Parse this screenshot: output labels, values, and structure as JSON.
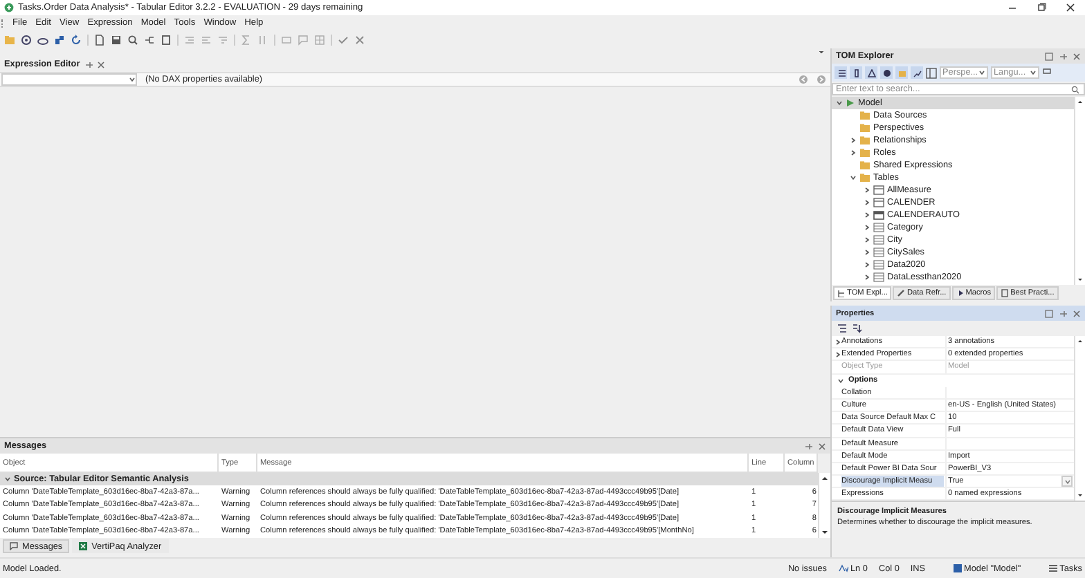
{
  "window": {
    "title": "Tasks.Order Data Analysis* - Tabular Editor 3.2.2 - EVALUATION - 29 days remaining"
  },
  "menu": [
    "File",
    "Edit",
    "View",
    "Expression",
    "Model",
    "Tools",
    "Window",
    "Help"
  ],
  "expression_editor": {
    "title": "Expression Editor",
    "message": "(No DAX properties available)"
  },
  "messages": {
    "title": "Messages",
    "columns": [
      "Object",
      "Type",
      "Message",
      "Line",
      "Column"
    ],
    "group": {
      "label": "Source: Tabular Editor Semantic Analysis",
      "expanded": true
    },
    "rows": [
      {
        "object": "Column 'DateTableTemplate_603d16ec-8ba7-42a3-87a...",
        "type": "Warning",
        "message": "Column references should always be fully qualified: 'DateTableTemplate_603d16ec-8ba7-42a3-87ad-4493ccc49b95'[Date]",
        "line": "1",
        "column": "6"
      },
      {
        "object": "Column 'DateTableTemplate_603d16ec-8ba7-42a3-87a...",
        "type": "Warning",
        "message": "Column references should always be fully qualified: 'DateTableTemplate_603d16ec-8ba7-42a3-87ad-4493ccc49b95'[Date]",
        "line": "1",
        "column": "7"
      },
      {
        "object": "Column 'DateTableTemplate_603d16ec-8ba7-42a3-87a...",
        "type": "Warning",
        "message": "Column references should always be fully qualified: 'DateTableTemplate_603d16ec-8ba7-42a3-87ad-4493ccc49b95'[Date]",
        "line": "1",
        "column": "8"
      },
      {
        "object": "Column 'DateTableTemplate_603d16ec-8ba7-42a3-87a...",
        "type": "Warning",
        "message": "Column references should always be fully qualified: 'DateTableTemplate_603d16ec-8ba7-42a3-87ad-4493ccc49b95'[MonthNo]",
        "line": "1",
        "column": "6"
      }
    ],
    "tabs": [
      {
        "label": "Messages",
        "selected": true
      },
      {
        "label": "VertiPaq Analyzer",
        "selected": false
      }
    ]
  },
  "tom_explorer": {
    "title": "TOM Explorer",
    "perspective": "Perspe...",
    "language": "Langu...",
    "search": {
      "placeholder": "Enter text to search..."
    },
    "tree": [
      {
        "label": "Model",
        "kind": "model",
        "expanded": true,
        "selected": true,
        "children": [
          {
            "label": "Data Sources",
            "kind": "folder",
            "selected": false
          },
          {
            "label": "Perspectives",
            "kind": "folder",
            "selected": false
          },
          {
            "label": "Relationships",
            "kind": "folder",
            "expanded": false,
            "selected": false
          },
          {
            "label": "Roles",
            "kind": "folder",
            "expanded": false,
            "selected": false
          },
          {
            "label": "Shared Expressions",
            "kind": "folder",
            "selected": false
          },
          {
            "label": "Tables",
            "kind": "folder",
            "expanded": true,
            "selected": false,
            "children": [
              {
                "label": "AllMeasure",
                "kind": "calc-table",
                "expanded": false,
                "selected": false
              },
              {
                "label": "CALENDER",
                "kind": "calc-table",
                "expanded": false,
                "selected": false
              },
              {
                "label": "CALENDERAUTO",
                "kind": "date-table",
                "expanded": false,
                "selected": false
              },
              {
                "label": "Category",
                "kind": "table",
                "expanded": false,
                "selected": false
              },
              {
                "label": "City",
                "kind": "table",
                "expanded": false,
                "selected": false
              },
              {
                "label": "CitySales",
                "kind": "table",
                "expanded": false,
                "selected": false
              },
              {
                "label": "Data2020",
                "kind": "table",
                "expanded": false,
                "selected": false
              },
              {
                "label": "DataLessthan2020",
                "kind": "table",
                "expanded": false,
                "selected": false
              }
            ]
          }
        ]
      }
    ],
    "tabs": [
      {
        "label": "TOM Expl...",
        "selected": true
      },
      {
        "label": "Data Refr...",
        "selected": false
      },
      {
        "label": "Macros",
        "selected": false
      },
      {
        "label": "Best Practi...",
        "selected": false
      }
    ]
  },
  "properties": {
    "title": "Properties",
    "rows": [
      {
        "kind": "property",
        "name": "Annotations",
        "value": "3 annotations",
        "expanded": false,
        "disabled": false,
        "selected": false
      },
      {
        "kind": "property",
        "name": "Extended Properties",
        "value": "0 extended properties",
        "expanded": false,
        "disabled": false,
        "selected": false
      },
      {
        "kind": "property",
        "name": "Object Type",
        "value": "Model",
        "disabled": true,
        "selected": false
      },
      {
        "kind": "category",
        "name": "Options",
        "expanded": true
      },
      {
        "kind": "property",
        "name": "Collation",
        "disabled": false,
        "selected": false
      },
      {
        "kind": "property",
        "name": "Culture",
        "value": "en-US - English (United States)",
        "disabled": false,
        "selected": false
      },
      {
        "kind": "property",
        "name": "Data Source Default Max C",
        "value": "10",
        "disabled": false,
        "selected": false
      },
      {
        "kind": "property",
        "name": "Default Data View",
        "value": "Full",
        "disabled": false,
        "selected": false
      },
      {
        "kind": "property",
        "name": "Default Measure",
        "disabled": false,
        "selected": false
      },
      {
        "kind": "property",
        "name": "Default Mode",
        "value": "Import",
        "disabled": false,
        "selected": false
      },
      {
        "kind": "property",
        "name": "Default Power BI Data Sour",
        "value": "PowerBI_V3",
        "disabled": false,
        "selected": false
      },
      {
        "kind": "property",
        "name": "Discourage Implicit Measu",
        "value": "True",
        "disabled": false,
        "selected": true
      },
      {
        "kind": "property",
        "name": "Expressions",
        "value": "0 named expressions",
        "disabled": false,
        "selected": false
      }
    ],
    "description": {
      "title": "Discourage Implicit Measures",
      "text": "Determines whether to discourage the implicit measures."
    }
  },
  "status_bar": {
    "message": "Model Loaded.",
    "issues": "No issues",
    "line": "Ln 0",
    "col": "Col 0",
    "mode": "INS",
    "model": "Model \"Model\"",
    "tasks": "Tasks"
  }
}
